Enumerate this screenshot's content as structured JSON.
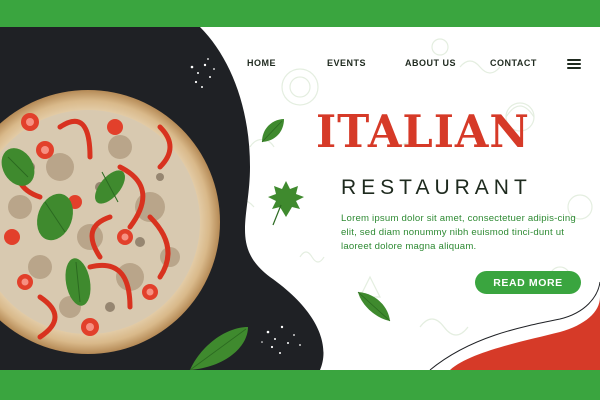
{
  "nav": {
    "items": [
      {
        "label": "HOME"
      },
      {
        "label": "EVENTS"
      },
      {
        "label": "ABOUT US"
      },
      {
        "label": "CONTACT"
      }
    ],
    "menu_icon": "hamburger-menu-icon"
  },
  "hero": {
    "title": "ITALIAN",
    "subtitle": "RESTAURANT",
    "description": "Lorem ipsum dolor sit amet, consectetuer adipis-cing elit, sed diam nonummy nibh euismod tinci-dunt ut laoreet dolore magna aliquam.",
    "cta_label": "READ MORE"
  },
  "colors": {
    "brand_green": "#3aa53f",
    "title_red": "#d63a28",
    "dark_board": "#1f2125",
    "text_dark": "#1e2a1e"
  },
  "image": {
    "subject": "pizza-with-tomatoes-peppers-mushrooms-basil"
  }
}
